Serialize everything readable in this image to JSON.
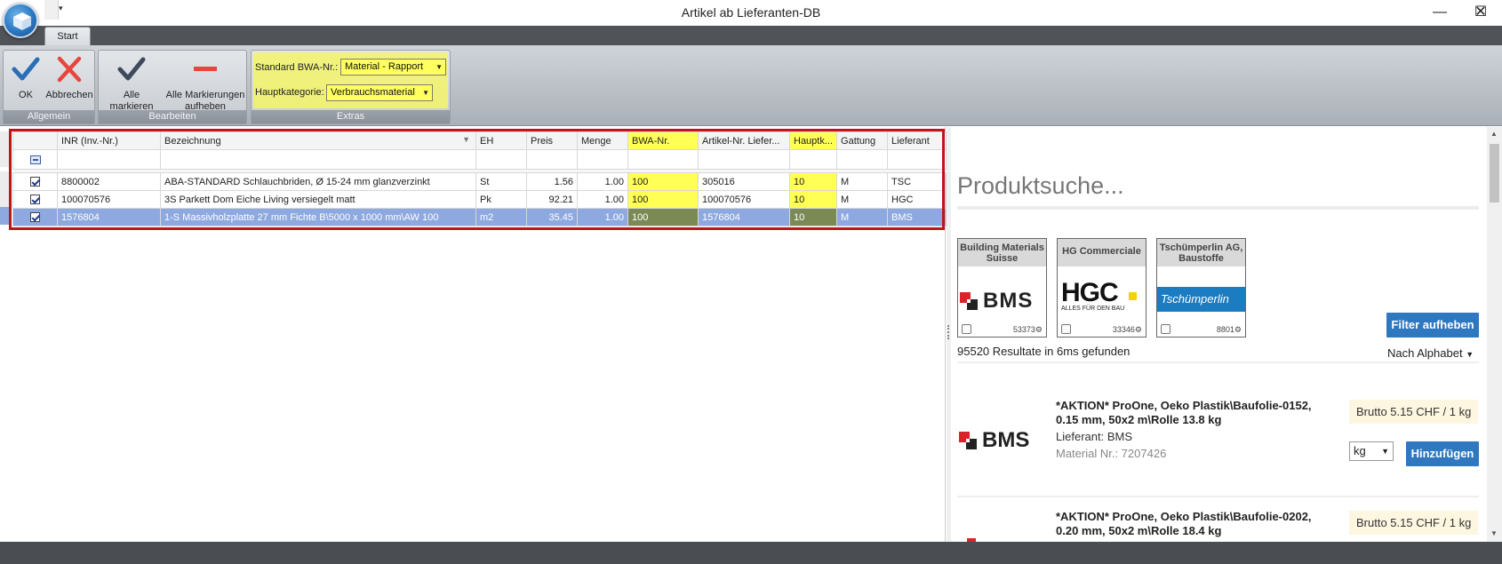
{
  "window": {
    "title": "Artikel ab Lieferanten-DB",
    "minimize": "—",
    "maximize": "☐",
    "close": "✕"
  },
  "ribbon": {
    "tab": "Start",
    "groups": {
      "allgemein": {
        "label": "Allgemein",
        "ok": "OK",
        "cancel": "Abbrechen"
      },
      "bearbeiten": {
        "label": "Bearbeiten",
        "mark_all": "Alle markieren",
        "unmark_all_1": "Alle Markierungen",
        "unmark_all_2": "aufheben"
      },
      "extras": {
        "label": "Extras",
        "bwa_label": "Standard BWA-Nr.:",
        "bwa_value": "Material - Rapport",
        "haupt_label": "Hauptkategorie:",
        "haupt_value": "Verbrauchsmaterial"
      }
    },
    "colors": {
      "highlight": "#ffff55",
      "accent": "#2f78c0",
      "outline": "#c0141c"
    }
  },
  "grid": {
    "columns": [
      "INR (Inv.-Nr.)",
      "Bezeichnung",
      "EH",
      "Preis",
      "Menge",
      "BWA-Nr.",
      "Artikel-Nr. Liefer...",
      "Hauptk...",
      "Gattung",
      "Lieferant"
    ],
    "rows": [
      {
        "checked": true,
        "inr": "8800002",
        "bez": "ABA-STANDARD Schlauchbriden, Ø 15-24 mm glanzverzinkt",
        "eh": "St",
        "preis": "1.56",
        "menge": "1.00",
        "bwa": "100",
        "artnr": "305016",
        "haupt": "10",
        "gattung": "M",
        "lief": "TSC"
      },
      {
        "checked": true,
        "inr": "100070576",
        "bez": "3S Parkett Dom Eiche Living versiegelt matt",
        "eh": "Pk",
        "preis": "92.21",
        "menge": "1.00",
        "bwa": "100",
        "artnr": "100070576",
        "haupt": "10",
        "gattung": "M",
        "lief": "HGC"
      },
      {
        "checked": true,
        "inr": "1576804",
        "bez": "1-S Massivholzplatte 27 mm Fichte B\\5000 x 1000 mm\\AW 100",
        "eh": "m2",
        "preis": "35.45",
        "menge": "1.00",
        "bwa": "100",
        "artnr": "1576804",
        "haupt": "10",
        "gattung": "M",
        "lief": "BMS"
      }
    ]
  },
  "search": {
    "title": "Produktsuche...",
    "suppliers": [
      {
        "name": "Building Materials Suisse",
        "count": "53373",
        "logo": "BMS"
      },
      {
        "name": "HG Commerciale",
        "count": "33346",
        "logo": "HGC",
        "tagline": "ALLES FÜR DEN BAU"
      },
      {
        "name": "Tschümperlin AG, Baustoffe",
        "count": "8801",
        "logo": "Tschümperlin"
      }
    ],
    "filter_btn": "Filter aufheben",
    "results": "95520 Resultate in 6ms gefunden",
    "sort": "Nach Alphabet",
    "products": [
      {
        "title": "*AKTION* ProOne, Oeko Plastik\\Baufolie-0152, 0.15 mm, 50x2 m\\Rolle 13.8 kg",
        "lieferant": "Lieferant: BMS",
        "material": "Material Nr.: 7207426",
        "price": "Brutto 5.15 CHF / 1 kg",
        "unit": "kg",
        "add": "Hinzufügen"
      },
      {
        "title": "*AKTION* ProOne, Oeko Plastik\\Baufolie-0202, 0.20 mm, 50x2 m\\Rolle 18.4 kg",
        "price": "Brutto 5.15 CHF / 1 kg"
      }
    ]
  }
}
